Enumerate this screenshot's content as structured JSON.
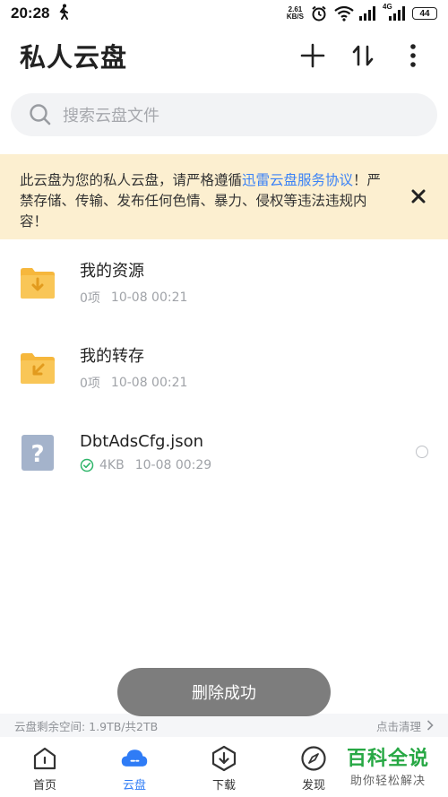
{
  "status_bar": {
    "time": "20:28",
    "net_speed_value": "2.61",
    "net_speed_unit": "KB/S",
    "network_type": "4G",
    "battery": "44"
  },
  "header": {
    "title": "私人云盘",
    "icons": [
      "plus-icon",
      "sort-icon",
      "more-vertical-icon"
    ]
  },
  "search": {
    "placeholder": "搜索云盘文件"
  },
  "notice": {
    "text_before": "此云盘为您的私人云盘，请严格遵循",
    "link": "迅雷云盘服务协议",
    "text_after": "！严禁存储、传输、发布任何色情、暴力、侵权等违法违规内容！"
  },
  "files": [
    {
      "name": "我的资源",
      "count": "0项",
      "date": "10-08 00:21",
      "icon": "folder-download-icon"
    },
    {
      "name": "我的转存",
      "count": "0项",
      "date": "10-08 00:21",
      "icon": "folder-transfer-icon"
    },
    {
      "name": "DbtAdsCfg.json",
      "size": "4KB",
      "date": "10-08 00:29",
      "icon": "unknown-file-icon",
      "status_icon": "check-circle-icon"
    }
  ],
  "toast": {
    "message": "删除成功"
  },
  "storage": {
    "info": "云盘剩余空间: 1.9TB/共2TB",
    "action": "点击清理"
  },
  "bottom_nav": [
    {
      "label": "首页",
      "icon": "home-icon"
    },
    {
      "label": "云盘",
      "icon": "cloud-icon",
      "active": true
    },
    {
      "label": "下载",
      "icon": "download-icon"
    },
    {
      "label": "发现",
      "icon": "compass-icon"
    },
    {
      "label": "",
      "icon": "profile-icon"
    }
  ],
  "watermark": {
    "title": "百科全说",
    "subtitle": "助你轻松解决"
  },
  "colors": {
    "accent": "#2f7cf6",
    "link": "#3b82f6",
    "notice_bg": "#fcefd0",
    "folder": "#f6b73c",
    "success": "#27a844"
  }
}
